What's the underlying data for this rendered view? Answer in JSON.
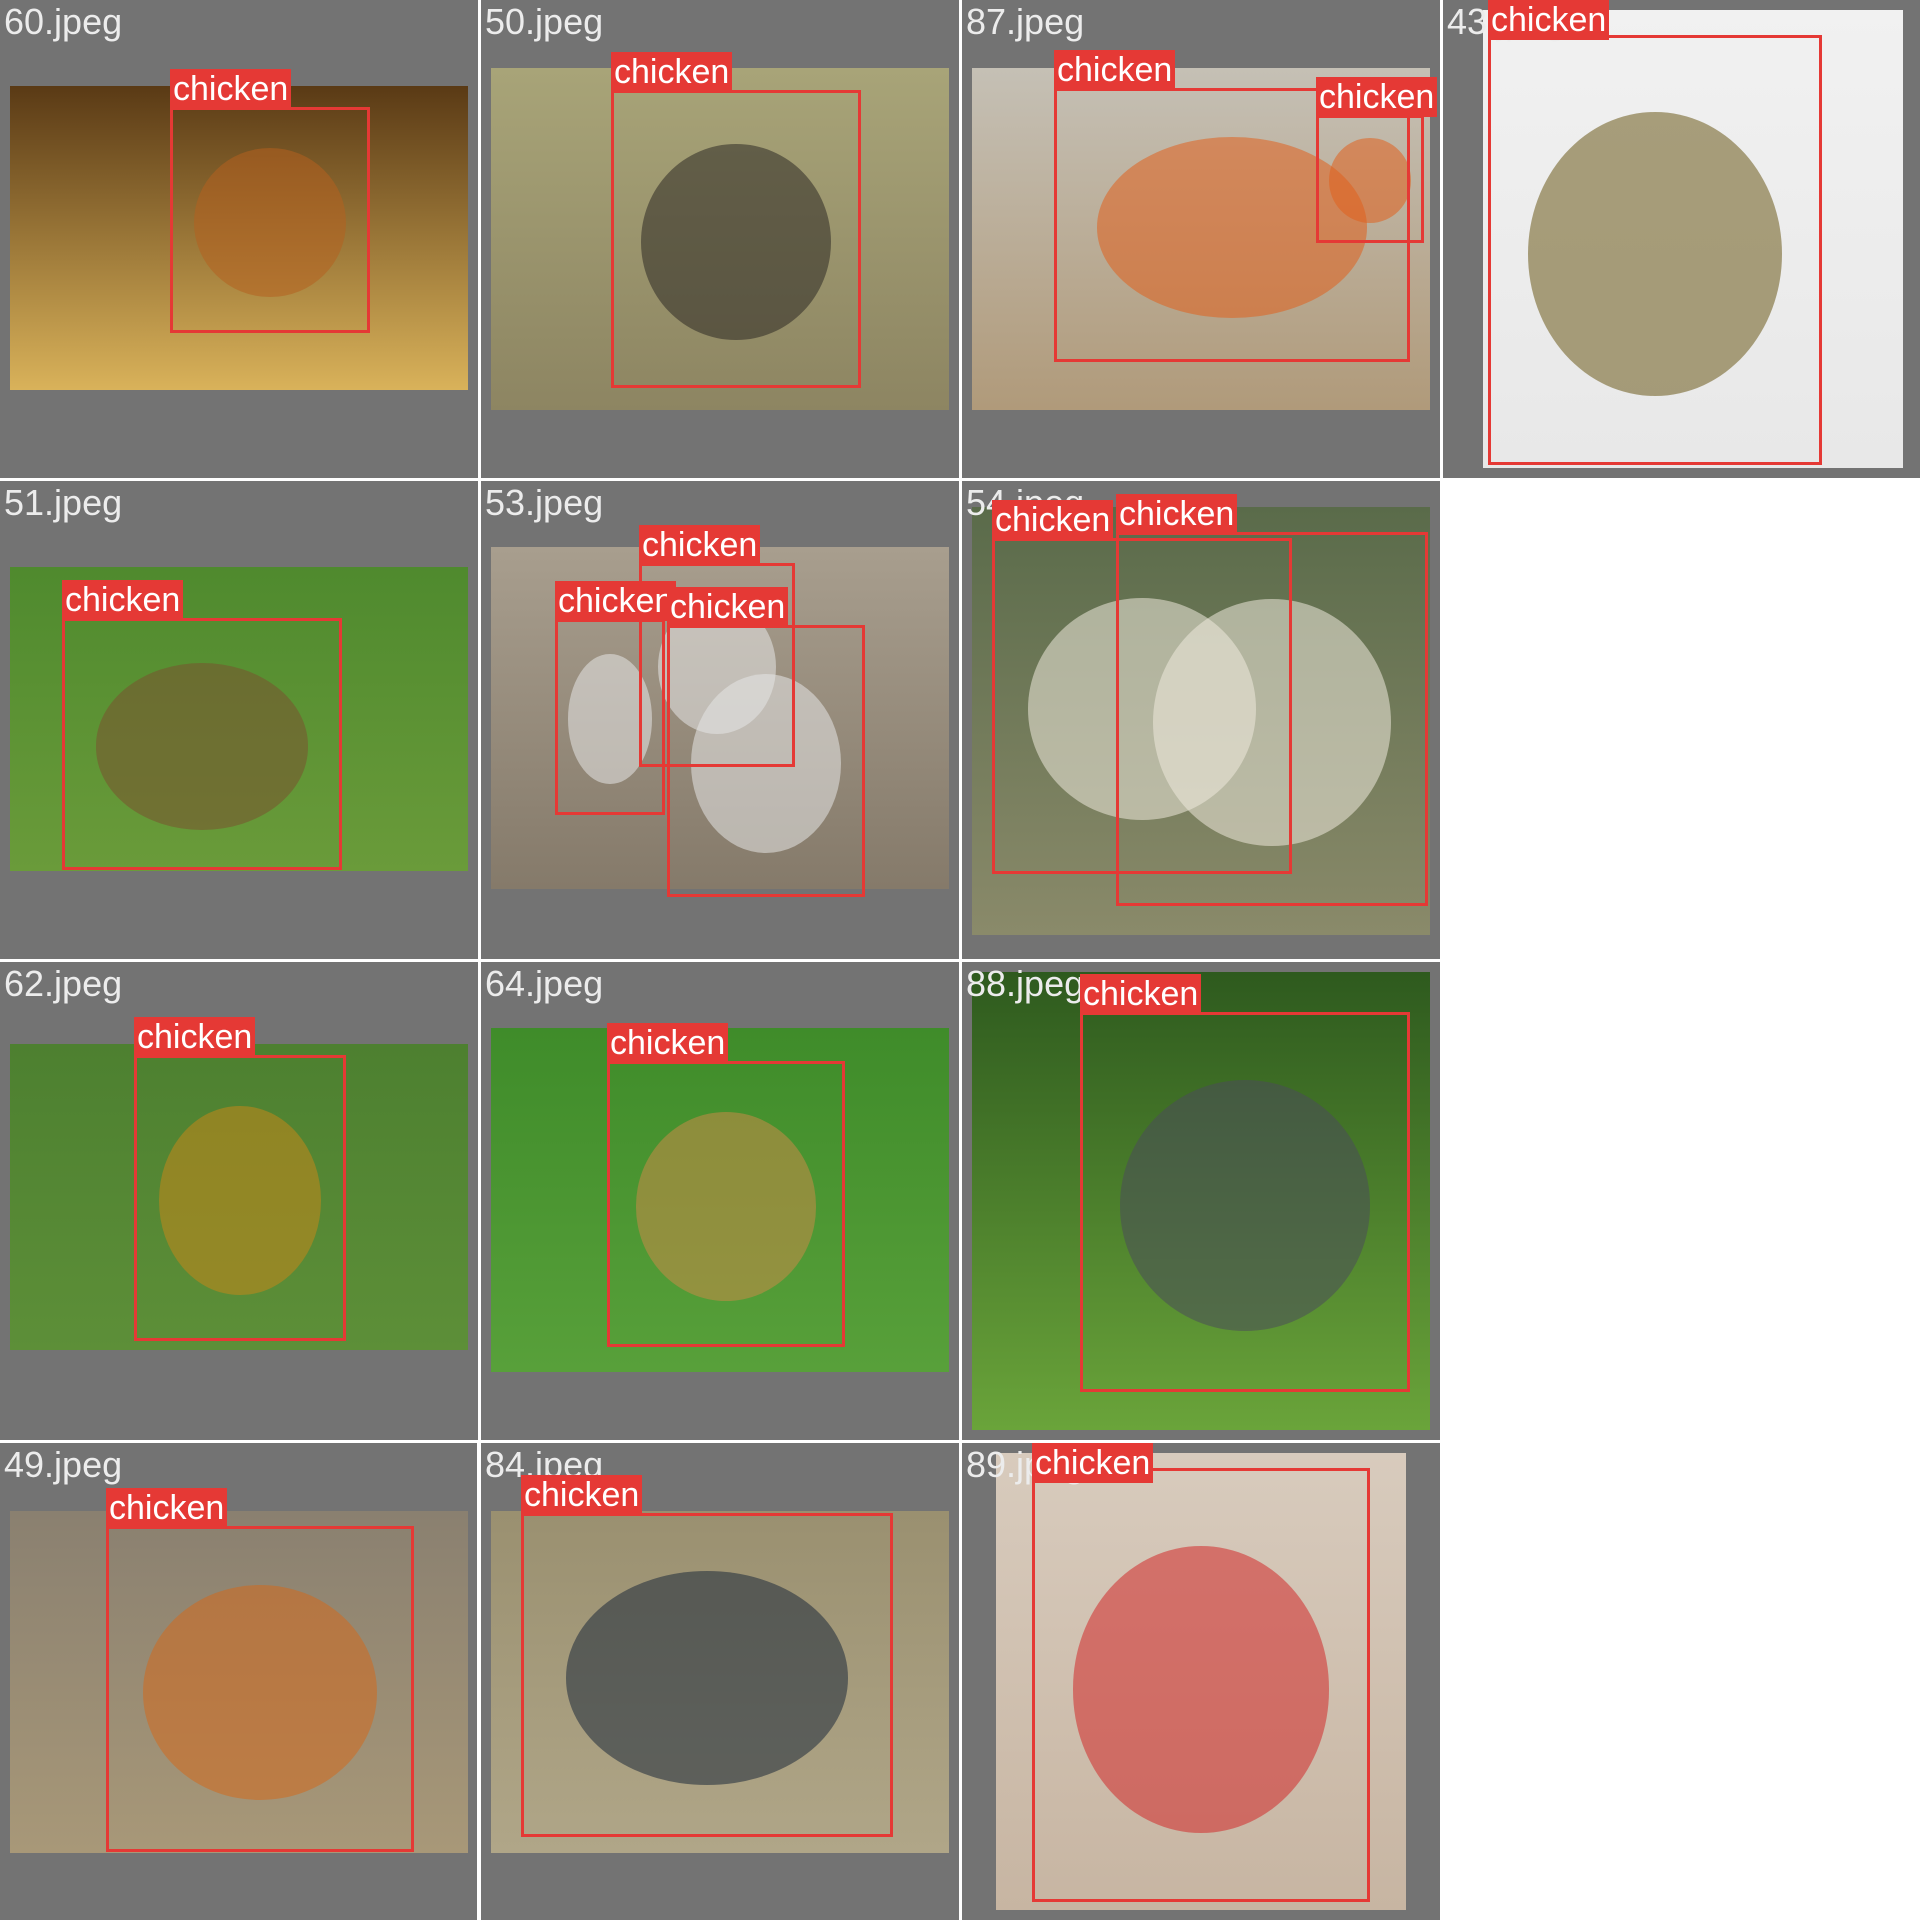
{
  "cells": [
    {
      "filename": "60.jpeg",
      "photo_colors": [
        "#5a3a15",
        "#d9b25a"
      ],
      "bird_color": "#b5601f",
      "detections": [
        {
          "label": "chicken"
        }
      ]
    },
    {
      "filename": "50.jpeg",
      "photo_colors": [
        "#a8a478",
        "#8d8562"
      ],
      "bird_color": "#2d2a25",
      "detections": [
        {
          "label": "chicken"
        }
      ]
    },
    {
      "filename": "87.jpeg",
      "photo_colors": [
        "#c5c0b5",
        "#b09a7a"
      ],
      "bird_color": "#e0601e",
      "detections": [
        {
          "label": "chicken"
        },
        {
          "label": "chicken"
        }
      ]
    },
    {
      "filename": "43.jpeg",
      "photo_colors": [
        "#f1f1f1",
        "#e8e8e8"
      ],
      "bird_color": "#6b5a1a",
      "detections": [
        {
          "label": "chicken"
        }
      ]
    },
    {
      "filename": "51.jpeg",
      "photo_colors": [
        "#4f8a2e",
        "#6a9b3a"
      ],
      "bird_color": "#7a5230",
      "detections": [
        {
          "label": "chicken"
        }
      ]
    },
    {
      "filename": "53.jpeg",
      "photo_colors": [
        "#a89e8e",
        "#857a6a"
      ],
      "bird_color": "#e6e6e6",
      "detections": [
        {
          "label": "chicken"
        },
        {
          "label": "chicken"
        },
        {
          "label": "chicken"
        }
      ]
    },
    {
      "filename": "54.jpeg",
      "photo_colors": [
        "#5a6b4a",
        "#8a8a6a"
      ],
      "bird_color": "#eeeadd",
      "detections": [
        {
          "label": "chicken"
        },
        {
          "label": "chicken"
        }
      ]
    },
    {
      "filename": "62.jpeg",
      "photo_colors": [
        "#4d8030",
        "#5d8f38"
      ],
      "bird_color": "#c4861a",
      "detections": [
        {
          "label": "chicken"
        }
      ]
    },
    {
      "filename": "64.jpeg",
      "photo_colors": [
        "#3f8c2a",
        "#58a03a"
      ],
      "bird_color": "#c98a47",
      "detections": [
        {
          "label": "chicken"
        }
      ]
    },
    {
      "filename": "88.jpeg",
      "photo_colors": [
        "#2e5a1e",
        "#6aa43a"
      ],
      "bird_color": "#4a4d5a",
      "detections": [
        {
          "label": "chicken"
        }
      ]
    },
    {
      "filename": "49.jpeg",
      "photo_colors": [
        "#8a8070",
        "#a89878"
      ],
      "bird_color": "#d2691e",
      "detections": [
        {
          "label": "chicken"
        }
      ]
    },
    {
      "filename": "84.jpeg",
      "photo_colors": [
        "#9a9070",
        "#b0a688"
      ],
      "bird_color": "#1e2a3a",
      "detections": [
        {
          "label": "chicken"
        }
      ]
    },
    {
      "filename": "89.jpeg",
      "photo_colors": [
        "#d8cbbd",
        "#c7b5a2"
      ],
      "bird_color": "#d22a2a",
      "detections": [
        {
          "label": "chicken"
        }
      ]
    }
  ]
}
